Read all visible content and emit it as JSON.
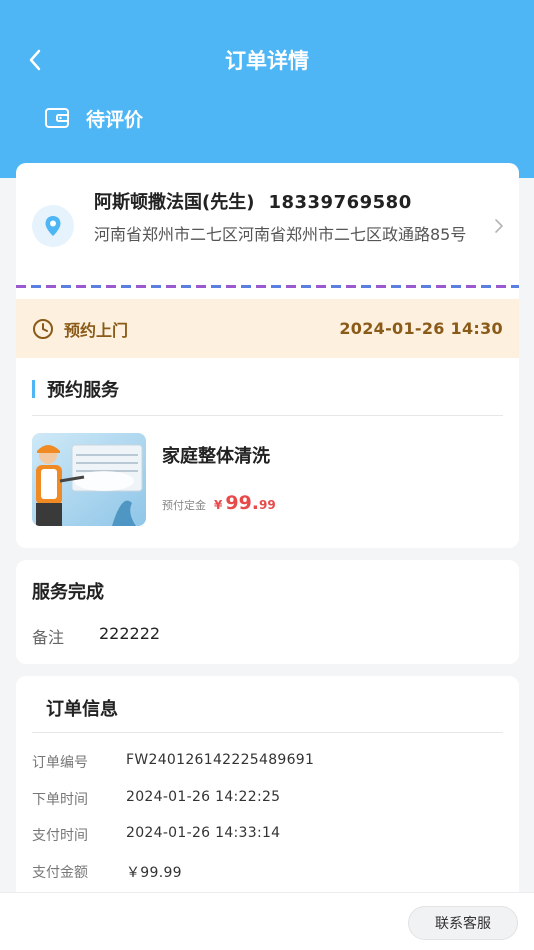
{
  "nav": {
    "title": "订单详情",
    "back_icon": "chevron-left-icon"
  },
  "status": {
    "text": "待评价",
    "icon": "wallet-icon"
  },
  "address": {
    "name": "阿斯顿撒法国(先生)",
    "phone": "18339769580",
    "detail": "河南省郑州市二七区河南省郑州市二七区政通路85号"
  },
  "appointment": {
    "label": "预约上门",
    "time": "2024-01-26 14:30"
  },
  "service": {
    "section_title": "预约服务",
    "name": "家庭整体清洗",
    "price_label": "预付定金",
    "currency": "¥",
    "price_main": "99.",
    "price_decimal": "99"
  },
  "completion": {
    "title": "服务完成",
    "remark_label": "备注",
    "remark_value": "222222"
  },
  "order_info": {
    "title": "订单信息",
    "rows": [
      {
        "label": "订单编号",
        "value": "FW240126142225489691"
      },
      {
        "label": "下单时间",
        "value": "2024-01-26 14:22:25"
      },
      {
        "label": "支付时间",
        "value": "2024-01-26 14:33:14"
      },
      {
        "label": "支付金额",
        "value": "￥99.99"
      }
    ]
  },
  "bottom": {
    "contact_label": "联系客服"
  },
  "colors": {
    "header": "#4fb6f5",
    "price": "#e84a4a",
    "appointment_text": "#8a5a18",
    "appointment_bg": "#fdf0de"
  }
}
